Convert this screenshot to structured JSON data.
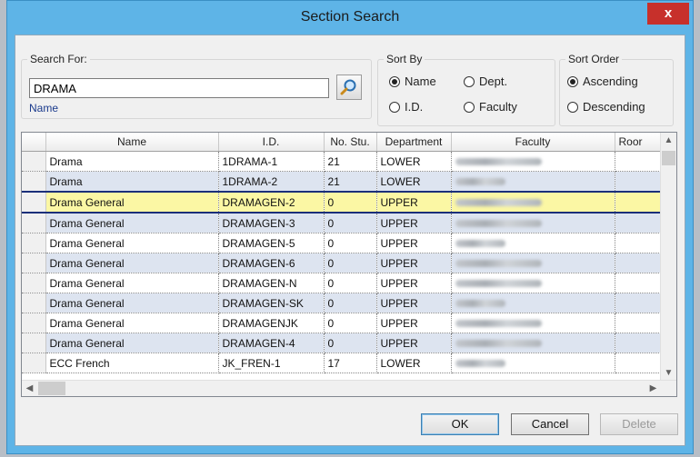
{
  "window": {
    "title": "Section Search",
    "close_glyph": "x"
  },
  "search": {
    "legend": "Search For:",
    "value": "DRAMA",
    "button_icon": "search-icon",
    "field_hint": "Name"
  },
  "sort_by": {
    "legend": "Sort By",
    "options": [
      {
        "label": "Name",
        "checked": true
      },
      {
        "label": "Dept.",
        "checked": false
      },
      {
        "label": "I.D.",
        "checked": false
      },
      {
        "label": "Faculty",
        "checked": false
      }
    ]
  },
  "sort_order": {
    "legend": "Sort Order",
    "options": [
      {
        "label": "Ascending",
        "checked": true
      },
      {
        "label": "Descending",
        "checked": false
      }
    ]
  },
  "grid": {
    "columns": [
      "Name",
      "I.D.",
      "No. Stu.",
      "Department",
      "Faculty",
      "Roor"
    ],
    "rows": [
      [
        "Drama",
        "1DRAMA-1",
        "21",
        "LOWER"
      ],
      [
        "Drama",
        "1DRAMA-2",
        "21",
        "LOWER"
      ],
      [
        "Drama General",
        "DRAMAGEN-2",
        "0",
        "UPPER"
      ],
      [
        "Drama General",
        "DRAMAGEN-3",
        "0",
        "UPPER"
      ],
      [
        "Drama General",
        "DRAMAGEN-5",
        "0",
        "UPPER"
      ],
      [
        "Drama General",
        "DRAMAGEN-6",
        "0",
        "UPPER"
      ],
      [
        "Drama General",
        "DRAMAGEN-N",
        "0",
        "UPPER"
      ],
      [
        "Drama General",
        "DRAMAGEN-SK",
        "0",
        "UPPER"
      ],
      [
        "Drama General",
        "DRAMAGENJK",
        "0",
        "UPPER"
      ],
      [
        "Drama General",
        "DRAMAGEN-4",
        "0",
        "UPPER"
      ],
      [
        "ECC French",
        "JK_FREN-1",
        "17",
        "LOWER"
      ]
    ],
    "selected_row": 2
  },
  "buttons": {
    "ok": "OK",
    "cancel": "Cancel",
    "delete": "Delete"
  },
  "colors": {
    "selected_row": "#fbf7a4",
    "alt_row": "#dde4f0",
    "title_bar": "#5eb4e7",
    "close": "#c7302b"
  }
}
